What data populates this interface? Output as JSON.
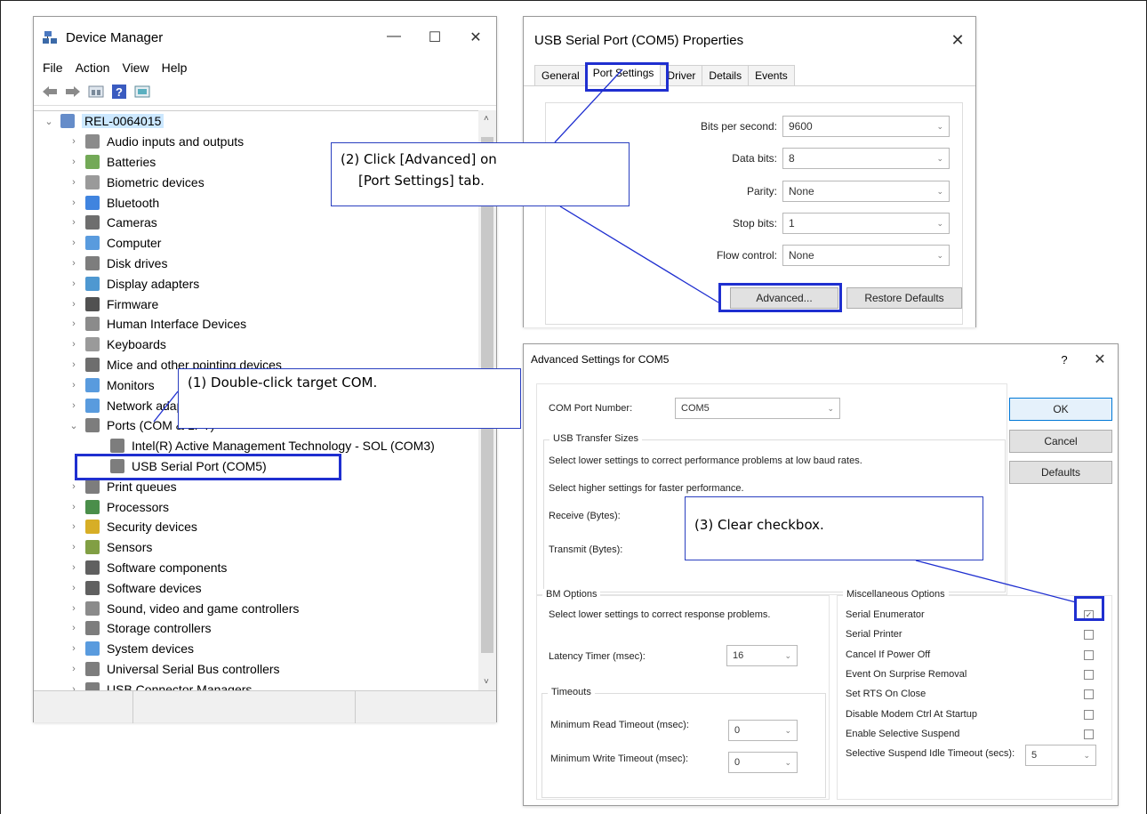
{
  "device_manager": {
    "title": "Device Manager",
    "controls": {
      "minimize": "—",
      "maximize": "☐",
      "close": "✕"
    },
    "menu": [
      "File",
      "Action",
      "View",
      "Help"
    ],
    "tree": [
      {
        "label": "REL-0064015",
        "level": 0,
        "chev": "⌄",
        "icon": "computer-icon",
        "color": "#4a78c0"
      },
      {
        "label": "Audio inputs and outputs",
        "level": 1,
        "chev": "›",
        "icon": "speaker-icon",
        "color": "#777"
      },
      {
        "label": "Batteries",
        "level": 1,
        "chev": "›",
        "icon": "battery-icon",
        "color": "#5a9a3a"
      },
      {
        "label": "Biometric devices",
        "level": 1,
        "chev": "›",
        "icon": "fingerprint-icon",
        "color": "#888"
      },
      {
        "label": "Bluetooth",
        "level": 1,
        "chev": "›",
        "icon": "bluetooth-icon",
        "color": "#1e6fd9"
      },
      {
        "label": "Cameras",
        "level": 1,
        "chev": "›",
        "icon": "camera-icon",
        "color": "#555"
      },
      {
        "label": "Computer",
        "level": 1,
        "chev": "›",
        "icon": "monitor-icon",
        "color": "#3c8ad8"
      },
      {
        "label": "Disk drives",
        "level": 1,
        "chev": "›",
        "icon": "disk-icon",
        "color": "#666"
      },
      {
        "label": "Display adapters",
        "level": 1,
        "chev": "›",
        "icon": "display-adapter-icon",
        "color": "#2f86c9"
      },
      {
        "label": "Firmware",
        "level": 1,
        "chev": "›",
        "icon": "firmware-icon",
        "color": "#333"
      },
      {
        "label": "Human Interface Devices",
        "level": 1,
        "chev": "›",
        "icon": "hid-icon",
        "color": "#777"
      },
      {
        "label": "Keyboards",
        "level": 1,
        "chev": "›",
        "icon": "keyboard-icon",
        "color": "#888"
      },
      {
        "label": "Mice and other pointing devices",
        "level": 1,
        "chev": "›",
        "icon": "mouse-icon",
        "color": "#555"
      },
      {
        "label": "Monitors",
        "level": 1,
        "chev": "›",
        "icon": "monitor-icon",
        "color": "#3c8ad8"
      },
      {
        "label": "Network adapters",
        "level": 1,
        "chev": "›",
        "icon": "network-icon",
        "color": "#3c8ad8"
      },
      {
        "label": "Ports (COM & LPT)",
        "level": 1,
        "chev": "⌄",
        "icon": "port-icon",
        "color": "#666"
      },
      {
        "label": "Intel(R) Active Management Technology - SOL (COM3)",
        "level": 2,
        "chev": "",
        "icon": "port-icon",
        "color": "#666"
      },
      {
        "label": "USB Serial Port (COM5)",
        "level": 2,
        "chev": "",
        "icon": "port-icon",
        "color": "#666"
      },
      {
        "label": "Print queues",
        "level": 1,
        "chev": "›",
        "icon": "printer-icon",
        "color": "#666"
      },
      {
        "label": "Processors",
        "level": 1,
        "chev": "›",
        "icon": "processor-icon",
        "color": "#2a7a2a"
      },
      {
        "label": "Security devices",
        "level": 1,
        "chev": "›",
        "icon": "security-icon",
        "color": "#d0a000"
      },
      {
        "label": "Sensors",
        "level": 1,
        "chev": "›",
        "icon": "sensor-icon",
        "color": "#6b8e23"
      },
      {
        "label": "Software components",
        "level": 1,
        "chev": "›",
        "icon": "software-component-icon",
        "color": "#444"
      },
      {
        "label": "Software devices",
        "level": 1,
        "chev": "›",
        "icon": "software-device-icon",
        "color": "#444"
      },
      {
        "label": "Sound, video and game controllers",
        "level": 1,
        "chev": "›",
        "icon": "speaker-icon",
        "color": "#777"
      },
      {
        "label": "Storage controllers",
        "level": 1,
        "chev": "›",
        "icon": "storage-icon",
        "color": "#666"
      },
      {
        "label": "System devices",
        "level": 1,
        "chev": "›",
        "icon": "folder-icon",
        "color": "#3c8ad8"
      },
      {
        "label": "Universal Serial Bus controllers",
        "level": 1,
        "chev": "›",
        "icon": "usb-icon",
        "color": "#666"
      },
      {
        "label": "USB Connector Managers",
        "level": 1,
        "chev": "›",
        "icon": "usb-icon",
        "color": "#666"
      }
    ]
  },
  "properties": {
    "title": "USB Serial Port (COM5) Properties",
    "close": "✕",
    "tabs": [
      "General",
      "Port Settings",
      "Driver",
      "Details",
      "Events"
    ],
    "fields": [
      {
        "label": "Bits per second:",
        "value": "9600"
      },
      {
        "label": "Data bits:",
        "value": "8"
      },
      {
        "label": "Parity:",
        "value": "None"
      },
      {
        "label": "Stop bits:",
        "value": "1"
      },
      {
        "label": "Flow control:",
        "value": "None"
      }
    ],
    "advanced_button": "Advanced...",
    "restore_button": "Restore Defaults"
  },
  "advanced": {
    "title": "Advanced Settings for COM5",
    "help": "?",
    "close": "✕",
    "com_port_label": "COM Port Number:",
    "com_port_value": "COM5",
    "ok": "OK",
    "cancel": "Cancel",
    "defaults": "Defaults",
    "usb_group": "USB Transfer Sizes",
    "usb_line1": "Select lower settings to correct performance problems at low baud rates.",
    "usb_line2": "Select higher settings for faster performance.",
    "receive_label": "Receive (Bytes):",
    "transmit_label": "Transmit (Bytes):",
    "bm_group": "BM Options",
    "bm_line": "Select lower settings to correct response problems.",
    "latency_label": "Latency Timer (msec):",
    "latency_value": "16",
    "timeouts_group": "Timeouts",
    "min_read_label": "Minimum Read Timeout (msec):",
    "min_read_value": "0",
    "min_write_label": "Minimum Write Timeout (msec):",
    "min_write_value": "0",
    "misc_group": "Miscellaneous Options",
    "misc": [
      {
        "label": "Serial Enumerator",
        "checked": true
      },
      {
        "label": "Serial Printer",
        "checked": false
      },
      {
        "label": "Cancel If Power Off",
        "checked": false
      },
      {
        "label": "Event On Surprise Removal",
        "checked": false
      },
      {
        "label": "Set RTS On Close",
        "checked": false
      },
      {
        "label": "Disable Modem Ctrl At Startup",
        "checked": false
      },
      {
        "label": "Enable Selective Suspend",
        "checked": false
      }
    ],
    "suspend_label": "Selective Suspend Idle Timeout (secs):",
    "suspend_value": "5"
  },
  "callouts": {
    "step1": "(1) Double-click target COM.",
    "step2_line1": "(2) Click [Advanced] on",
    "step2_line2": "[Port Settings] tab.",
    "step3": "(3) Clear checkbox."
  },
  "accent_color": "#1f2fd0"
}
